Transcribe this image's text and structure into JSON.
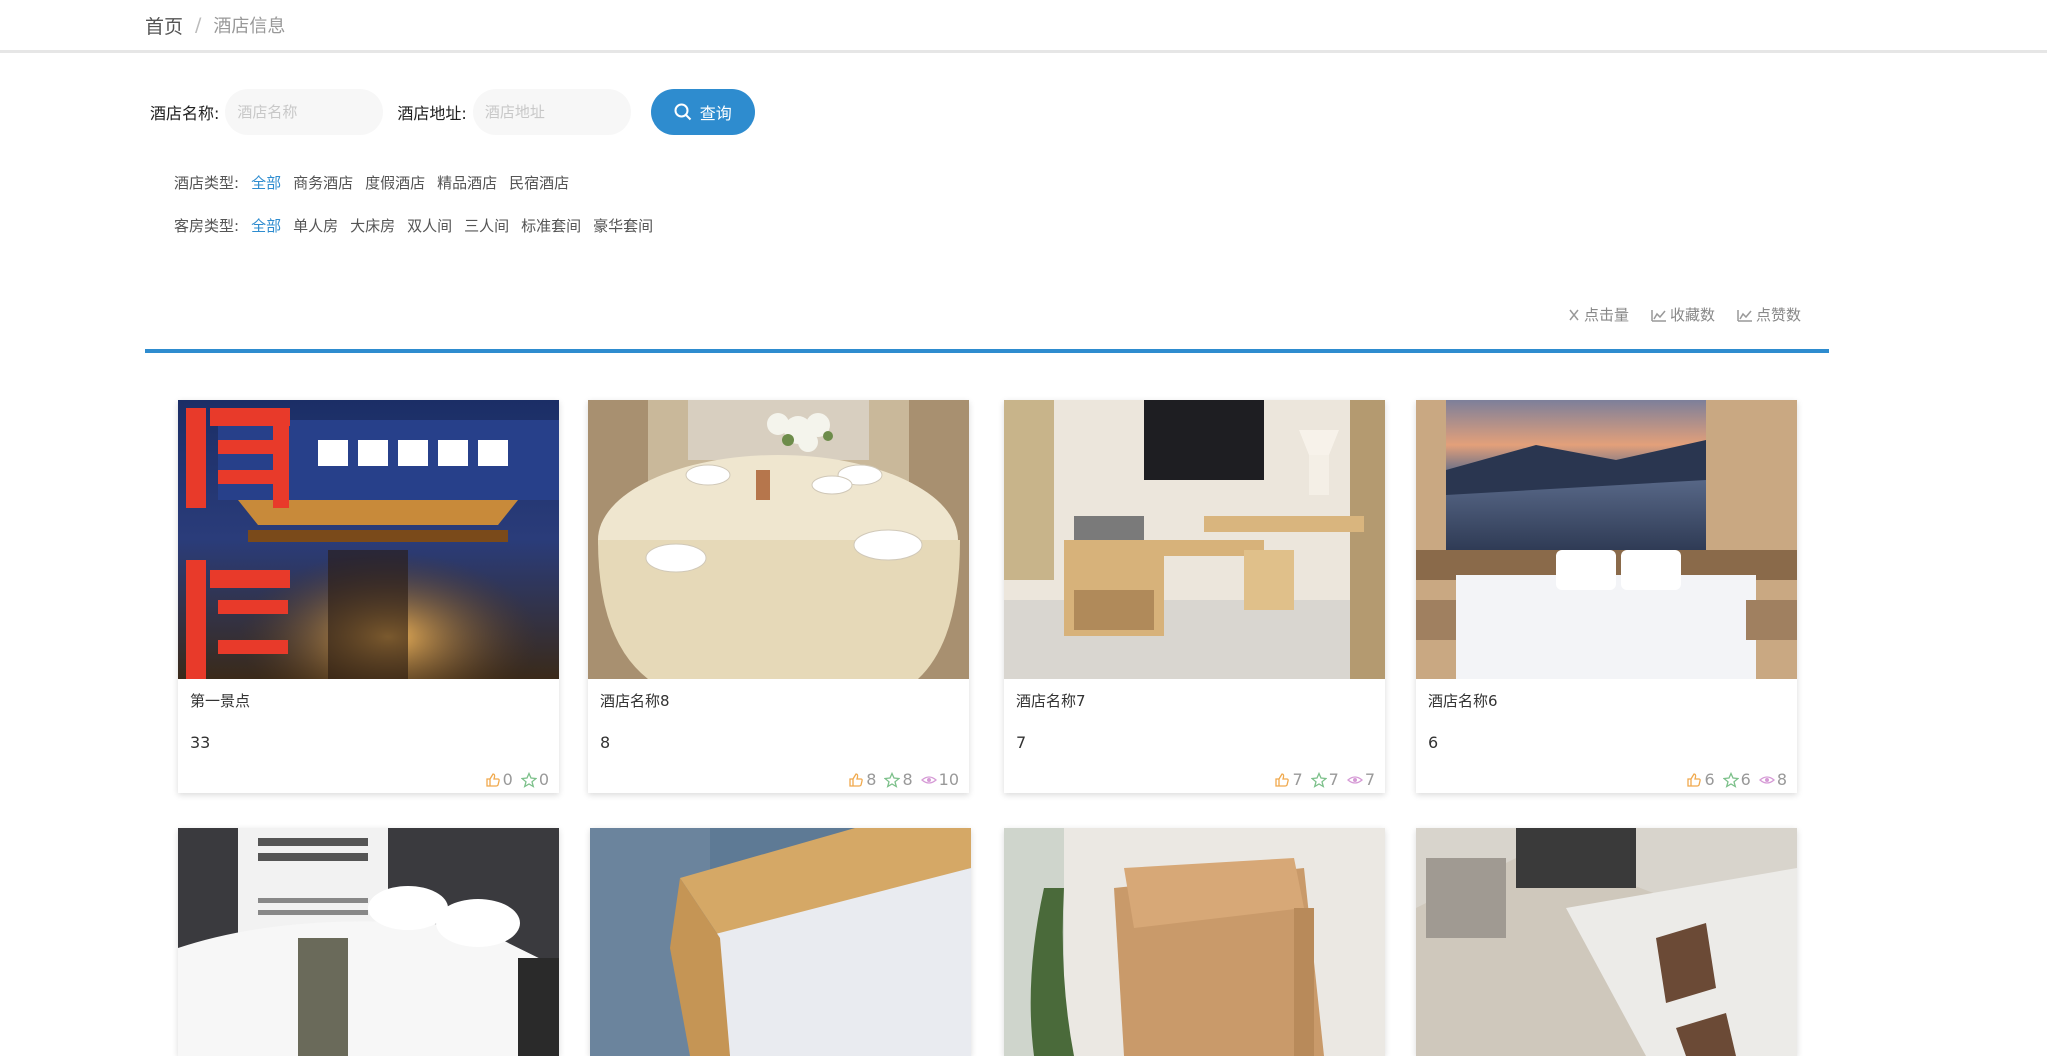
{
  "breadcrumb": {
    "home": "首页",
    "separator": "/",
    "current": "酒店信息"
  },
  "search": {
    "name_label": "酒店名称:",
    "name_placeholder": "酒店名称",
    "address_label": "酒店地址:",
    "address_placeholder": "酒店地址",
    "button_label": "查询"
  },
  "filters": {
    "hotel_type": {
      "label": "酒店类型:",
      "options": [
        "全部",
        "商务酒店",
        "度假酒店",
        "精品酒店",
        "民宿酒店"
      ],
      "selected": "全部"
    },
    "room_type": {
      "label": "客房类型:",
      "options": [
        "全部",
        "单人房",
        "大床房",
        "双人间",
        "三人间",
        "标准套间",
        "豪华套间"
      ],
      "selected": "全部"
    }
  },
  "sort": {
    "clicks": "点击量",
    "favorites": "收藏数",
    "likes": "点赞数"
  },
  "colors": {
    "accent": "#2e8ccf",
    "like": "#f0a94d",
    "favorite": "#7cc08a",
    "view": "#d69bd6"
  },
  "cards": [
    {
      "name": "第一景点",
      "number": "33",
      "likes": "0",
      "favorites": "0",
      "views": null,
      "image": "hotel-facade"
    },
    {
      "name": "酒店名称8",
      "number": "8",
      "likes": "8",
      "favorites": "8",
      "views": "10",
      "image": "dining-table"
    },
    {
      "name": "酒店名称7",
      "number": "7",
      "likes": "7",
      "favorites": "7",
      "views": "7",
      "image": "room-desk"
    },
    {
      "name": "酒店名称6",
      "number": "6",
      "likes": "6",
      "favorites": "6",
      "views": "8",
      "image": "sea-bedroom"
    }
  ],
  "second_row_images": [
    "white-bedding",
    "wooden-bed",
    "tan-blanket",
    "aerial-room"
  ]
}
